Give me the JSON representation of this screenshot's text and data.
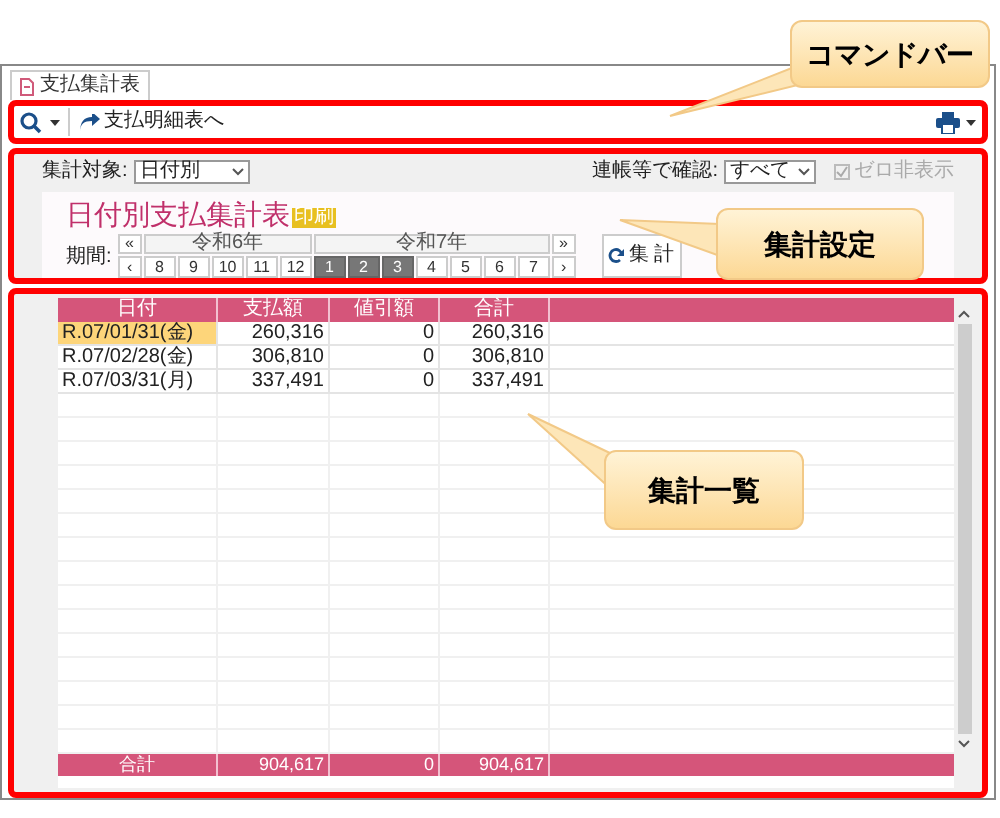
{
  "tab": {
    "label": "支払集計表",
    "selected": true
  },
  "toolbar": {
    "link": "支払明細表へ"
  },
  "settings": {
    "target_label": "集計対象:",
    "target_value": "日付別",
    "confirm_label": "連帳等で確認:",
    "confirm_value": "すべて",
    "zero_hide": {
      "label": "ゼロ非表示",
      "checked": true,
      "disabled": true
    }
  },
  "report": {
    "title": "日付別支払集計表",
    "badge": "印刷",
    "period_label": "期間:",
    "years": [
      "令和6年",
      "令和7年"
    ],
    "months": [
      {
        "label": "8",
        "selected": false
      },
      {
        "label": "9",
        "selected": false
      },
      {
        "label": "10",
        "selected": false
      },
      {
        "label": "11",
        "selected": false
      },
      {
        "label": "12",
        "selected": false
      },
      {
        "label": "1",
        "selected": true
      },
      {
        "label": "2",
        "selected": true
      },
      {
        "label": "3",
        "selected": true
      },
      {
        "label": "4",
        "selected": false
      },
      {
        "label": "5",
        "selected": false
      },
      {
        "label": "6",
        "selected": false
      },
      {
        "label": "7",
        "selected": false
      }
    ],
    "nav": {
      "prev_year": "«",
      "next_year": "»",
      "prev": "‹",
      "next": "›"
    },
    "aggregate_button": "集 計"
  },
  "table": {
    "columns": [
      "日付",
      "支払額",
      "値引額",
      "合計"
    ],
    "rows": [
      {
        "cells": [
          "R.07/01/31(金)",
          "260,316",
          "0",
          "260,316"
        ],
        "selected": true
      },
      {
        "cells": [
          "R.07/02/28(金)",
          "306,810",
          "0",
          "306,810"
        ],
        "selected": false
      },
      {
        "cells": [
          "R.07/03/31(月)",
          "337,491",
          "0",
          "337,491"
        ],
        "selected": false
      }
    ],
    "footer": [
      "合計",
      "904,617",
      "0",
      "904,617"
    ]
  },
  "callouts": [
    {
      "text": "コマンドバー"
    },
    {
      "text": "集計設定"
    },
    {
      "text": "集計一覧"
    }
  ]
}
